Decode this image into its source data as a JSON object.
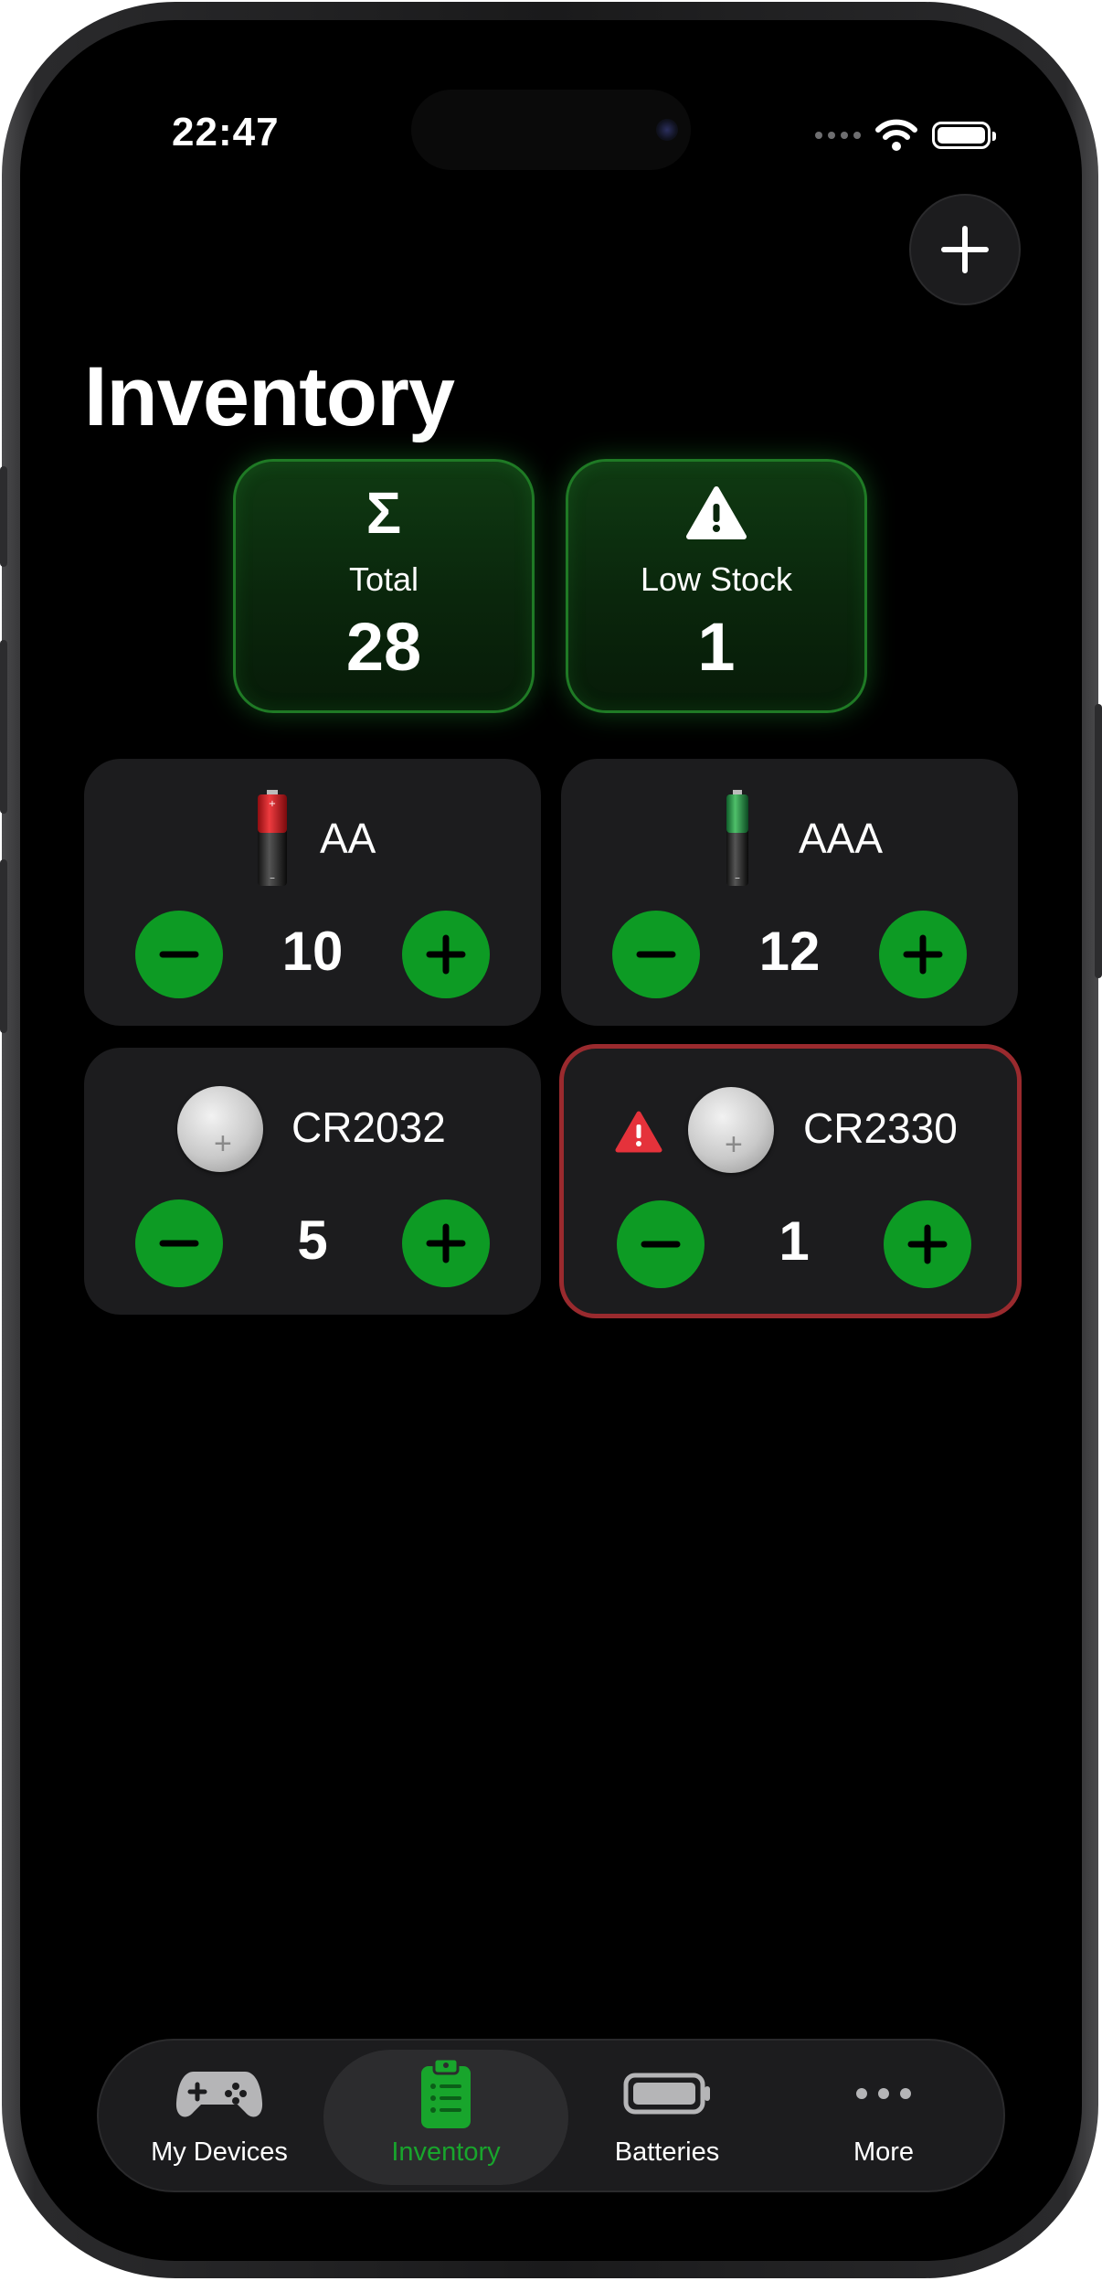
{
  "status_bar": {
    "time": "22:47"
  },
  "header": {
    "title": "Inventory"
  },
  "stats": [
    {
      "label": "Total",
      "value": "28",
      "icon": "sigma-icon"
    },
    {
      "label": "Low Stock",
      "value": "1",
      "icon": "warning-triangle-icon"
    }
  ],
  "batteries": [
    {
      "name": "AA",
      "quantity": "10",
      "low_stock": false,
      "icon": "aa-battery-icon"
    },
    {
      "name": "AAA",
      "quantity": "12",
      "low_stock": false,
      "icon": "aaa-battery-icon"
    },
    {
      "name": "CR2032",
      "quantity": "5",
      "low_stock": false,
      "icon": "coin-cell-icon"
    },
    {
      "name": "CR2330",
      "quantity": "1",
      "low_stock": true,
      "icon": "coin-cell-icon"
    }
  ],
  "tabs": [
    {
      "label": "My Devices",
      "icon": "gamepad-icon",
      "active": false
    },
    {
      "label": "Inventory",
      "icon": "clipboard-list-icon",
      "active": true
    },
    {
      "label": "Batteries",
      "icon": "battery-icon",
      "active": false
    },
    {
      "label": "More",
      "icon": "ellipsis-icon",
      "active": false
    }
  ],
  "colors": {
    "accent_green": "#0d9b24",
    "active_tab_green": "#18a52c",
    "warning_red": "#e5323b",
    "low_stock_border": "#9a2a2e",
    "card_background": "#1c1c1e"
  }
}
